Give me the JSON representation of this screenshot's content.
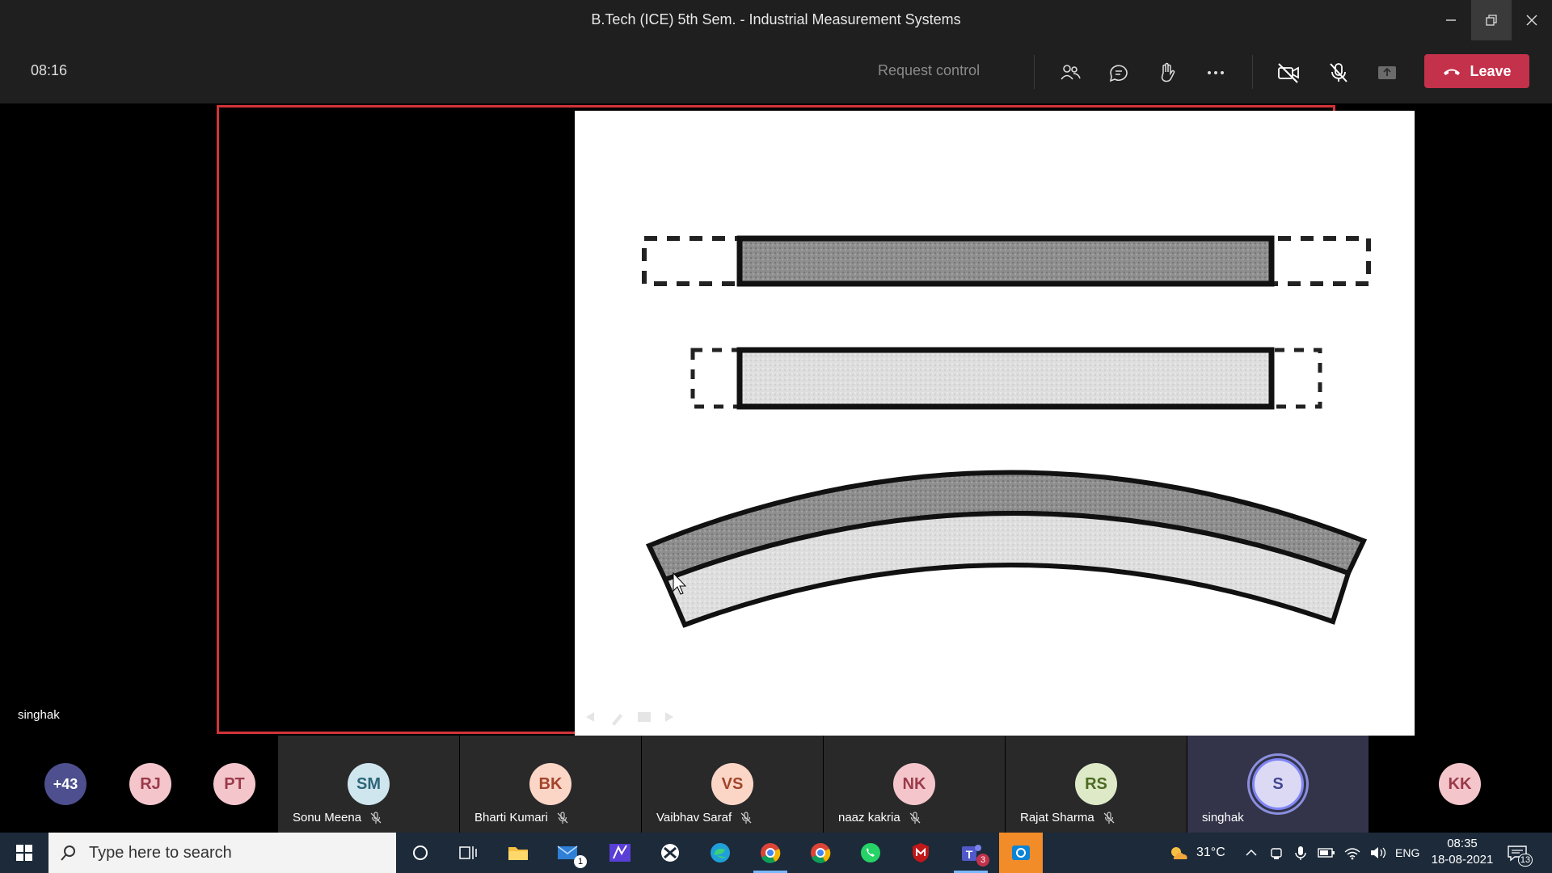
{
  "window": {
    "title": "B.Tech (ICE) 5th Sem. - Industrial Measurement Systems"
  },
  "meeting": {
    "timer": "08:16",
    "request_control": "Request control",
    "leave_label": "Leave"
  },
  "presenter": {
    "name": "singhak"
  },
  "participants": {
    "overflow": "+43",
    "avatars_only": [
      {
        "initials": "RJ",
        "color": "#f4c6cc",
        "text_color": "#9b3a4a"
      },
      {
        "initials": "PT",
        "color": "#f4c6cc",
        "text_color": "#9b3a4a"
      }
    ],
    "tiles": [
      {
        "initials": "SM",
        "name": "Sonu Meena",
        "color": "#cfe6ee",
        "text_color": "#2c6678"
      },
      {
        "initials": "BK",
        "name": "Bharti Kumari",
        "color": "#fbd6c7",
        "text_color": "#a2452a"
      },
      {
        "initials": "VS",
        "name": "Vaibhav Saraf",
        "color": "#fbd6c7",
        "text_color": "#a2452a"
      },
      {
        "initials": "NK",
        "name": "naaz kakria",
        "color": "#f4c6cc",
        "text_color": "#9b3a4a"
      },
      {
        "initials": "RS",
        "name": "Rajat Sharma",
        "color": "#dde9c7",
        "text_color": "#4d6a22"
      }
    ],
    "self": {
      "initials": "S",
      "name": "singhak",
      "color": "#dcd9f4",
      "text_color": "#444791"
    },
    "last": {
      "initials": "KK",
      "color": "#f4c6cc",
      "text_color": "#9b3a4a"
    }
  },
  "taskbar": {
    "search_placeholder": "Type here to search",
    "mail_badge": "1",
    "teams_badge": "3",
    "weather": "31°C",
    "language": "ENG",
    "time": "08:35",
    "date": "18-08-2021",
    "notifications": "13"
  }
}
